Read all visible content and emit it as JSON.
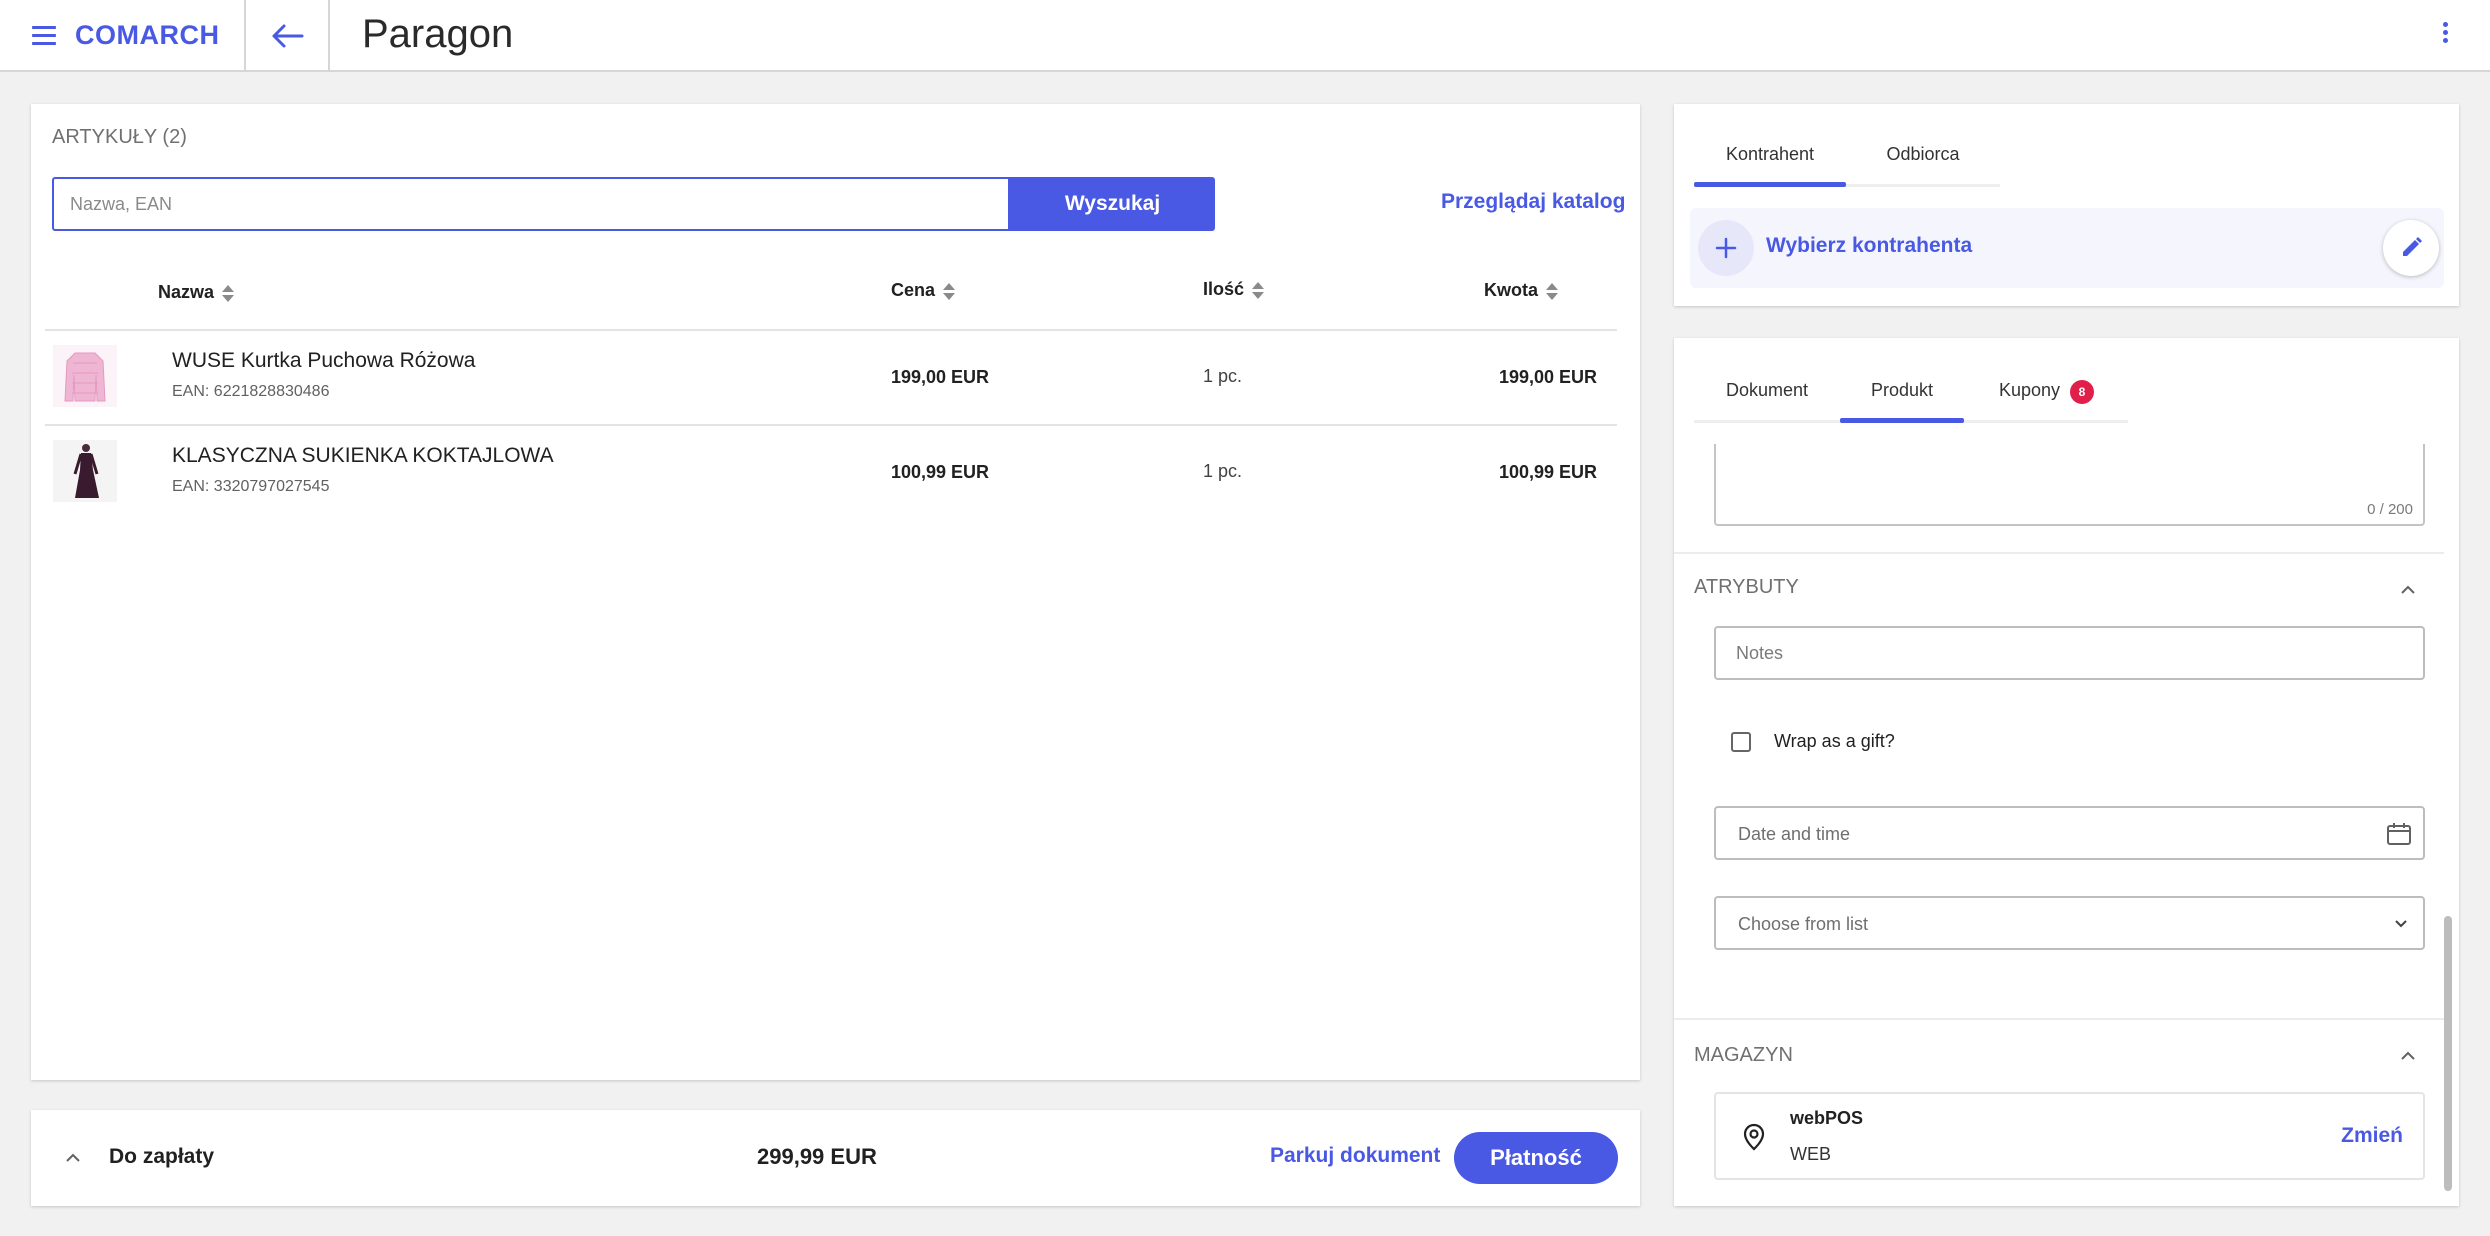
{
  "header": {
    "brand": "COMARCH",
    "title": "Paragon"
  },
  "articles": {
    "section_label": "ARTYKUŁY (2)",
    "search_placeholder": "Nazwa, EAN",
    "search_button": "Wyszukaj",
    "catalog_link": "Przeglądaj katalog",
    "columns": {
      "name": "Nazwa",
      "price": "Cena",
      "qty": "Ilość",
      "amount": "Kwota"
    },
    "items": [
      {
        "name": "WUSE Kurtka Puchowa Różowa",
        "ean": "EAN: 6221828830486",
        "price": "199,00 EUR",
        "qty": "1 pc.",
        "amount": "199,00 EUR"
      },
      {
        "name": "KLASYCZNA SUKIENKA KOKTAJLOWA",
        "ean": "EAN: 3320797027545",
        "price": "100,99 EUR",
        "qty": "1 pc.",
        "amount": "100,99 EUR"
      }
    ]
  },
  "payment": {
    "label": "Do zapłaty",
    "total": "299,99 EUR",
    "park": "Parkuj dokument",
    "pay": "Płatność"
  },
  "contractor": {
    "tabs": [
      "Kontrahent",
      "Odbiorca"
    ],
    "choose": "Wybierz kontrahenta"
  },
  "details": {
    "tabs": [
      "Dokument",
      "Produkt",
      "Kupony"
    ],
    "coupon_count": "8",
    "counter": "0 / 200",
    "attributes_label": "ATRYBUTY",
    "notes_placeholder": "Notes",
    "gift_label": "Wrap as a gift?",
    "date_placeholder": "Date and time",
    "list_placeholder": "Choose from list",
    "warehouse_label": "MAGAZYN",
    "warehouse_name": "webPOS",
    "warehouse_code": "WEB",
    "warehouse_change": "Zmień"
  },
  "colors": {
    "accent": "#4959e3",
    "badge": "#e0204a"
  }
}
